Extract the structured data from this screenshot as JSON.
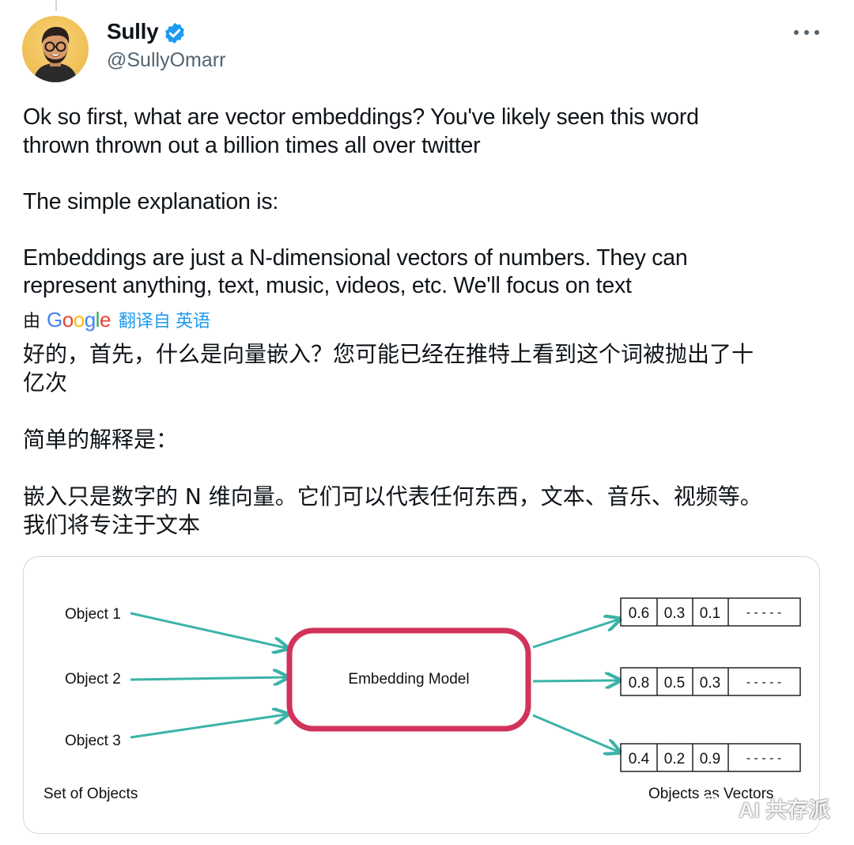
{
  "author": {
    "name": "Sully",
    "handle": "@SullyOmarr"
  },
  "icons": {
    "verified": "verified-badge-icon",
    "more": "more-options-icon",
    "watermark": "wechat-icon"
  },
  "tweet": {
    "text": "Ok so first, what are vector embeddings? You've likely seen this word\nthrown thrown out a billion times all over twitter\n\nThe simple explanation is:\n\nEmbeddings are just a N-dimensional vectors of numbers. They can\nrepresent anything, text, music, videos, etc. We'll focus on text"
  },
  "translation": {
    "by_label": "由",
    "provider": "Google",
    "link_label": "翻译自 英语",
    "text": "好的，首先，什么是向量嵌入？您可能已经在推特上看到这个词被抛出了十\n亿次\n\n简单的解释是：\n\n嵌入只是数字的 N 维向量。它们可以代表任何东西，文本、音乐、视频等。\n我们将专注于文本"
  },
  "diagram": {
    "inputs": [
      "Object 1",
      "Object 2",
      "Object 3"
    ],
    "model_label": "Embedding Model",
    "left_caption": "Set of Objects",
    "right_caption": "Objects as Vectors",
    "vectors": [
      [
        "0.6",
        "0.3",
        "0.1",
        "- - - - -"
      ],
      [
        "0.8",
        "0.5",
        "0.3",
        "- - - - -"
      ],
      [
        "0.4",
        "0.2",
        "0.9",
        "- - - - -"
      ]
    ],
    "colors": {
      "arrow": "#3bb3a8",
      "model_border": "#d2335b"
    }
  },
  "watermark": {
    "text": "AI 共存派"
  }
}
